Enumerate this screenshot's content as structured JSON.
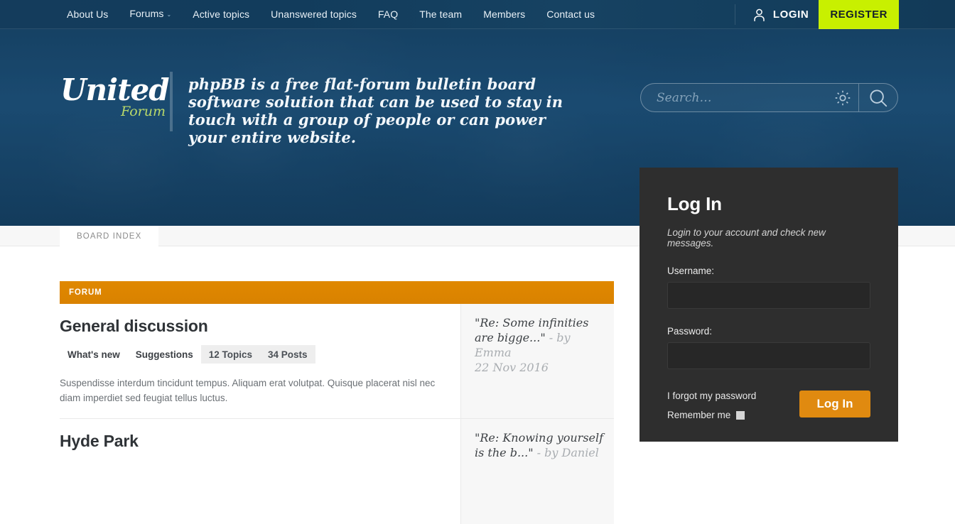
{
  "nav": {
    "links": [
      {
        "label": "About Us",
        "caret": false
      },
      {
        "label": "Forums",
        "caret": true
      },
      {
        "label": "Active topics",
        "caret": false
      },
      {
        "label": "Unanswered topics",
        "caret": false
      },
      {
        "label": "FAQ",
        "caret": false
      },
      {
        "label": "The team",
        "caret": false
      },
      {
        "label": "Members",
        "caret": false
      },
      {
        "label": "Contact us",
        "caret": false
      }
    ],
    "caret_glyph": "⌄",
    "login_label": "LOGIN",
    "register_label": "REGISTER",
    "register_color": "#c8f000",
    "bar_color": "#123c5c"
  },
  "hero": {
    "brand_name": "United",
    "brand_sub": "Forum",
    "tagline": "phpBB is a free flat-forum bulletin board software solution that can be used to stay in touch with a group of people or can power your entire website.",
    "search": {
      "value": "",
      "placeholder": "Search…",
      "settings_icon": "gear-icon",
      "submit_icon": "magnifier-icon"
    }
  },
  "breadcrumb": {
    "items": [
      "BOARD INDEX"
    ]
  },
  "forum": {
    "header_label": "FORUM",
    "header_color": "#de8500",
    "rows": [
      {
        "title": "General discussion",
        "tags": [
          {
            "label": "What's new",
            "muted": false
          },
          {
            "label": "Suggestions",
            "muted": false
          },
          {
            "label": "12 Topics",
            "muted": true
          },
          {
            "label": "34 Posts",
            "muted": true
          }
        ],
        "description": "Suspendisse interdum tincidunt tempus. Aliquam erat volutpat. Quisque placerat nisl nec diam imperdiet sed feugiat tellus luctus.",
        "last_post": {
          "title": "\"Re: Some infinities are bigge...\"",
          "by": "- by Emma",
          "date": "22 Nov 2016"
        }
      },
      {
        "title": "Hyde Park",
        "tags": [],
        "description": "",
        "last_post": {
          "title": "\"Re: Knowing yourself is the b...\"",
          "by": "- by Daniel",
          "date": ""
        }
      }
    ]
  },
  "login_panel": {
    "title": "Log In",
    "subtitle": "Login to your account and check new messages.",
    "username_label": "Username:",
    "username_value": "",
    "password_label": "Password:",
    "password_value": "",
    "forgot_label": "I forgot my password",
    "remember_label": "Remember me",
    "submit_label": "Log In",
    "submit_color": "#e08a10"
  }
}
